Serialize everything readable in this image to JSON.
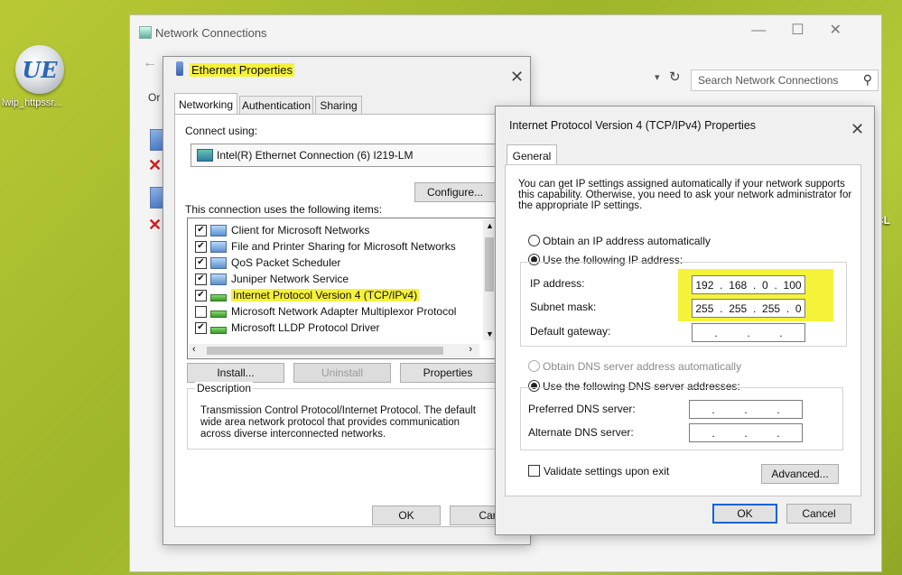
{
  "desktop": {
    "icon_letters": "UE",
    "icon_label": "lwip_httpssr...",
    "right_edge_text": "ECL"
  },
  "network_window": {
    "title": "Network Connections",
    "search_placeholder": "Search Network Connections",
    "partial_label": "Or"
  },
  "ethernet_dialog": {
    "title": "Ethernet Properties",
    "tabs": [
      "Networking",
      "Authentication",
      "Sharing"
    ],
    "connect_using_label": "Connect using:",
    "adapter_name": "Intel(R) Ethernet Connection (6) I219-LM",
    "configure_button": "Configure...",
    "items_label": "This connection uses the following items:",
    "items": [
      {
        "label": "Client for Microsoft Networks",
        "checked": true
      },
      {
        "label": "File and Printer Sharing for Microsoft Networks",
        "checked": true
      },
      {
        "label": "QoS Packet Scheduler",
        "checked": true
      },
      {
        "label": "Juniper Network Service",
        "checked": true
      },
      {
        "label": "Internet Protocol Version 4 (TCP/IPv4)",
        "checked": true
      },
      {
        "label": "Microsoft Network Adapter Multiplexor Protocol",
        "checked": false
      },
      {
        "label": "Microsoft LLDP Protocol Driver",
        "checked": true
      }
    ],
    "install_button": "Install...",
    "uninstall_button": "Uninstall",
    "properties_button": "Properties",
    "description_title": "Description",
    "description_text": "Transmission Control Protocol/Internet Protocol. The default wide area network protocol that provides communication across diverse interconnected networks.",
    "ok_button": "OK",
    "cancel_button": "Cance"
  },
  "ipv4_dialog": {
    "title": "Internet Protocol Version 4 (TCP/IPv4) Properties",
    "tab": "General",
    "intro_text": "You can get IP settings assigned automatically if your network supports this capability. Otherwise, you need to ask your network administrator for the appropriate IP settings.",
    "obtain_ip_auto": "Obtain an IP address automatically",
    "use_following_ip": "Use the following IP address:",
    "ip_address_label": "IP address:",
    "ip_address": [
      "192",
      "168",
      "0",
      "100"
    ],
    "subnet_mask_label": "Subnet mask:",
    "subnet_mask": [
      "255",
      "255",
      "255",
      "0"
    ],
    "default_gateway_label": "Default gateway:",
    "obtain_dns_auto": "Obtain DNS server address automatically",
    "use_following_dns": "Use the following DNS server addresses:",
    "preferred_dns_label": "Preferred DNS server:",
    "alternate_dns_label": "Alternate DNS server:",
    "validate_label": "Validate settings upon exit",
    "advanced_button": "Advanced...",
    "ok_button": "OK",
    "cancel_button": "Cancel"
  },
  "colors": {
    "highlight": "#f5f23a",
    "default_button_border": "#0a64d6",
    "desktop_green": "#a9bd2e"
  },
  "icons": [
    "search-icon",
    "refresh-icon",
    "close-icon",
    "network-adapter-icon",
    "error-x-icon",
    "scroll-arrow-icon"
  ]
}
